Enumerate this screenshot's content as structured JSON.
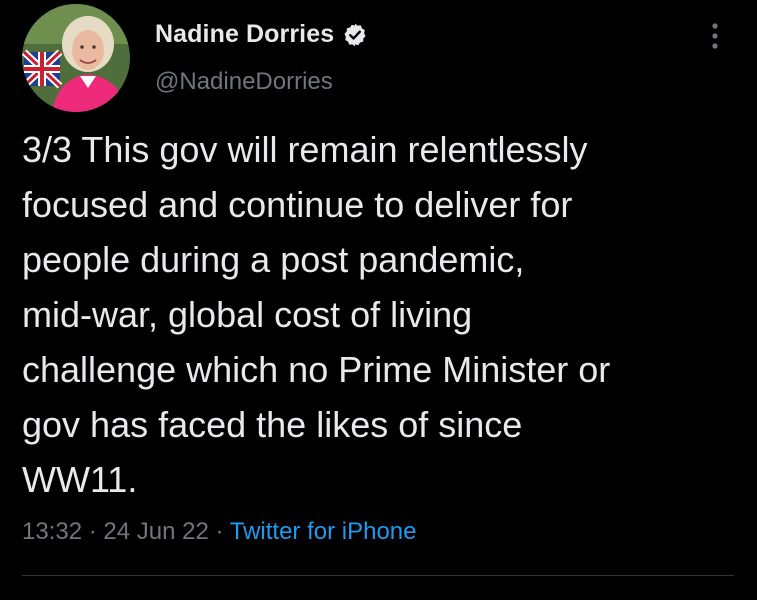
{
  "author": {
    "display_name": "Nadine Dorries",
    "handle": "@NadineDorries",
    "avatar_icon": "profile-photo",
    "verified_icon": "verified-badge-icon"
  },
  "tweet": {
    "text_lines": [
      "3/3 This gov will remain relentlessly",
      "focused and continue to deliver for",
      "people during a post pandemic,",
      "mid-war, global cost of living",
      "challenge which no Prime Minister or",
      "gov has faced the likes of since",
      "WW11."
    ]
  },
  "meta": {
    "time": "13:32",
    "separator": "·",
    "date": "24 Jun 22",
    "source": "Twitter for iPhone"
  },
  "menu": {
    "icon": "more-options-icon"
  },
  "colors": {
    "background": "#000000",
    "primary_text": "#e7e9ea",
    "secondary_text": "#71767b",
    "link": "#1d9bf0",
    "divider": "#2f3336"
  }
}
